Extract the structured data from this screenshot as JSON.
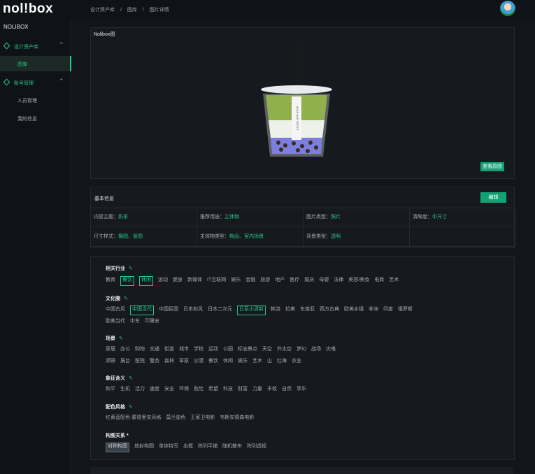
{
  "app": {
    "logo": "nol!box"
  },
  "breadcrumb": [
    "设计资产库",
    "/",
    "图库",
    "/",
    "图片详情"
  ],
  "sidebar": {
    "title": "NOLIBOX",
    "groups": [
      {
        "label": "设计资产库",
        "items": [
          {
            "label": "图库"
          }
        ]
      },
      {
        "label": "账号管理",
        "items": [
          {
            "label": "人员管理"
          },
          {
            "label": "我的信息"
          }
        ]
      }
    ]
  },
  "image_panel": {
    "title": "Nolibox图",
    "view_button": "查看原图",
    "cup_label": "AKAR BAR SPOTS"
  },
  "basic_info": {
    "title": "基本信息",
    "edit_button": "编辑",
    "rows": [
      [
        {
          "label": "内容主题：",
          "value": "奶茶"
        },
        {
          "label": "推荐用途：",
          "value": "主体物"
        },
        {
          "label": "图片类型：",
          "value": "照片"
        },
        {
          "label": "清晰度：",
          "value": "中尺寸"
        }
      ],
      [
        {
          "label": "尺寸样式：",
          "value": "横图、竖图"
        },
        {
          "label": "主体物类型：",
          "value": "物品、室内场景"
        },
        {
          "label": "背景类型：",
          "value": "透明"
        },
        {
          "label": "",
          "value": ""
        }
      ]
    ]
  },
  "tag_sections": [
    {
      "title": "相关行业",
      "rows": [
        [
          {
            "t": "教育"
          },
          {
            "t": "餐饮",
            "sel": true
          },
          {
            "t": "休闲",
            "sel": true
          },
          {
            "t": "运动"
          },
          {
            "t": "健身"
          },
          {
            "t": "新媒体"
          },
          {
            "t": "IT互联网"
          },
          {
            "t": "娱乐"
          },
          {
            "t": "金融"
          },
          {
            "t": "旅游"
          },
          {
            "t": "地产"
          },
          {
            "t": "医疗"
          },
          {
            "t": "婚庆"
          },
          {
            "t": "母婴"
          },
          {
            "t": "法律"
          },
          {
            "t": "美容/美妆"
          },
          {
            "t": "电商"
          },
          {
            "t": "艺术"
          }
        ]
      ]
    },
    {
      "title": "文化圈",
      "rows": [
        [
          {
            "t": "中国古风"
          },
          {
            "t": "中国当代",
            "sel": true
          },
          {
            "t": "中国民国"
          },
          {
            "t": "日本和风"
          },
          {
            "t": "日本二次元"
          },
          {
            "t": "日系小清新",
            "sel": true
          },
          {
            "t": "韩流"
          },
          {
            "t": "拉美"
          },
          {
            "t": "东南亚"
          },
          {
            "t": "西方古典"
          },
          {
            "t": "欧美乡镇"
          },
          {
            "t": "非洲"
          },
          {
            "t": "印度"
          },
          {
            "t": "俄罗斯"
          }
        ],
        [
          {
            "t": "欧美当代"
          },
          {
            "t": "中东"
          },
          {
            "t": "印第安"
          }
        ]
      ]
    },
    {
      "title": "场景",
      "rows": [
        [
          {
            "t": "家居"
          },
          {
            "t": "办公"
          },
          {
            "t": "购物"
          },
          {
            "t": "交通"
          },
          {
            "t": "街道"
          },
          {
            "t": "城市"
          },
          {
            "t": "学校"
          },
          {
            "t": "运动"
          },
          {
            "t": "公园"
          },
          {
            "t": "标志景点"
          },
          {
            "t": "天空"
          },
          {
            "t": "外太空"
          },
          {
            "t": "梦幻"
          },
          {
            "t": "战场"
          },
          {
            "t": "灾难"
          }
        ],
        [
          {
            "t": "郊野"
          },
          {
            "t": "展台"
          },
          {
            "t": "医院"
          },
          {
            "t": "警务"
          },
          {
            "t": "森林"
          },
          {
            "t": "草原"
          },
          {
            "t": "沙漠"
          },
          {
            "t": "餐饮"
          },
          {
            "t": "休闲"
          },
          {
            "t": "娱乐"
          },
          {
            "t": "艺术"
          },
          {
            "t": "山"
          },
          {
            "t": "红海"
          },
          {
            "t": "农业"
          }
        ]
      ]
    },
    {
      "title": "象征含义",
      "rows": [
        [
          {
            "t": "和平"
          },
          {
            "t": "生机"
          },
          {
            "t": "活力"
          },
          {
            "t": "速度"
          },
          {
            "t": "安全"
          },
          {
            "t": "环保"
          },
          {
            "t": "危险"
          },
          {
            "t": "希望"
          },
          {
            "t": "科技"
          },
          {
            "t": "财富"
          },
          {
            "t": "力量"
          },
          {
            "t": "丰收"
          },
          {
            "t": "自然"
          },
          {
            "t": "享乐"
          }
        ]
      ]
    },
    {
      "title": "配色风格",
      "rows": [
        [
          {
            "t": "红黄蓝配色-蒙德里安风格"
          },
          {
            "t": "莫兰迪色"
          },
          {
            "t": "王家卫电影"
          },
          {
            "t": "韦斯安德森电影"
          }
        ]
      ]
    },
    {
      "title": "构图关系 *",
      "rows": [
        [
          {
            "t": "对称构图",
            "dash": true
          },
          {
            "t": "放射构图"
          },
          {
            "t": "单体特写"
          },
          {
            "t": "出框"
          },
          {
            "t": "阵列平铺"
          },
          {
            "t": "随机散布"
          },
          {
            "t": "阵列透视"
          }
        ]
      ]
    }
  ]
}
